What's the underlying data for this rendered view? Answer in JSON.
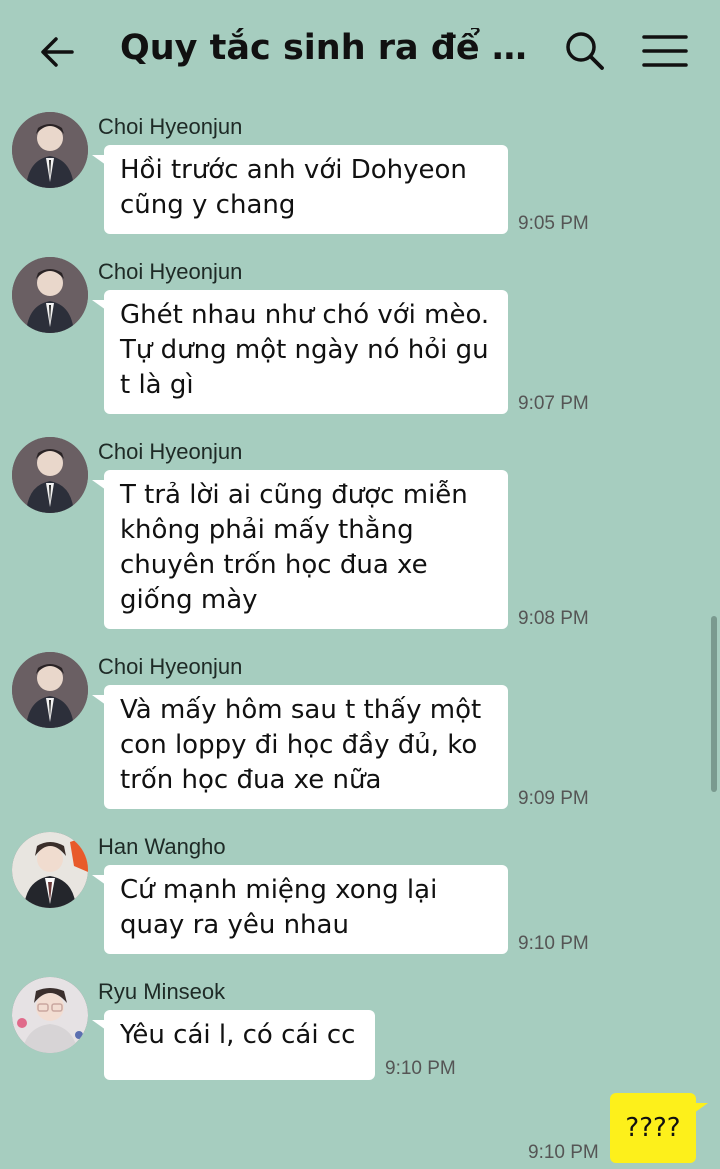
{
  "header": {
    "title": "Quy tắc sinh ra để duy t..."
  },
  "messages": [
    {
      "sender": "Choi Hyeonjun",
      "text": "Hồi trước anh với Dohyeon\ncũng y chang",
      "time": "9:05 PM"
    },
    {
      "sender": "Choi Hyeonjun",
      "text": "Ghét nhau như chó với mèo.\nTự dưng một ngày nó hỏi gu\nt là gì",
      "time": "9:07 PM"
    },
    {
      "sender": "Choi Hyeonjun",
      "text": "T trả lời ai cũng được miễn\nkhông phải mấy thằng\nchuyên trốn học đua xe\ngiống mày",
      "time": "9:08 PM"
    },
    {
      "sender": "Choi Hyeonjun",
      "text": "Và mấy hôm sau t thấy một\ncon loppy đi học đầy đủ, ko\ntrốn học đua xe nữa",
      "time": "9:09 PM"
    },
    {
      "sender": "Han Wangho",
      "text": "Cứ mạnh miệng xong lại\nquay ra yêu nhau",
      "time": "9:10 PM"
    },
    {
      "sender": "Ryu Minseok",
      "text": "Yêu cái l, có cái cc",
      "time": "9:10 PM"
    }
  ],
  "my_message": {
    "text": "????",
    "time": "9:10 PM"
  },
  "colors": {
    "background": "#a6cdbf",
    "my_bubble": "#fdf01b",
    "their_bubble": "#ffffff"
  }
}
